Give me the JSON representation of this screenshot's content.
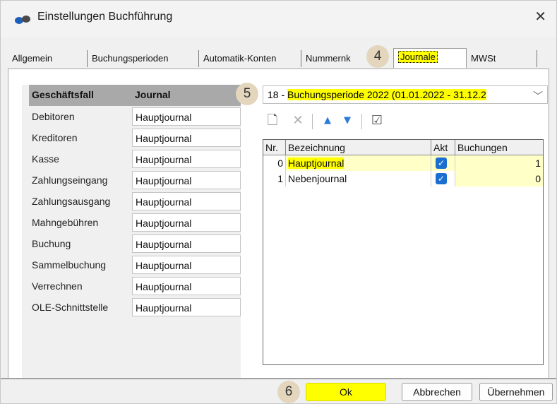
{
  "window": {
    "title": "Einstellungen Buchführung",
    "close_glyph": "✕",
    "icon": "app-icon"
  },
  "tabs": [
    {
      "label": "Allgemein"
    },
    {
      "label": "Buchungsperioden"
    },
    {
      "label": "Automatik-Konten"
    },
    {
      "label": "Nummernk"
    },
    {
      "label": "Journale",
      "selected": true
    },
    {
      "label": "MWSt"
    }
  ],
  "badges": {
    "b4": "4",
    "b5": "5",
    "b6": "6"
  },
  "left_table": {
    "headers": {
      "col1": "Geschäftsfall",
      "col2": "Journal"
    },
    "rows": [
      {
        "fall": "Debitoren",
        "journal": "Hauptjournal"
      },
      {
        "fall": "Kreditoren",
        "journal": "Hauptjournal"
      },
      {
        "fall": "Kasse",
        "journal": "Hauptjournal"
      },
      {
        "fall": "Zahlungseingang",
        "journal": "Hauptjournal"
      },
      {
        "fall": "Zahlungsausgang",
        "journal": "Hauptjournal"
      },
      {
        "fall": "Mahngebühren",
        "journal": "Hauptjournal"
      },
      {
        "fall": "Buchung",
        "journal": "Hauptjournal"
      },
      {
        "fall": "Sammelbuchung",
        "journal": "Hauptjournal"
      },
      {
        "fall": "Verrechnen",
        "journal": "Hauptjournal"
      },
      {
        "fall": "OLE-Schnittstelle",
        "journal": "Hauptjournal"
      }
    ]
  },
  "period_combo": {
    "prefix": "18 - ",
    "value": "Buchungsperiode 2022 (01.01.2022 - 31.12.2",
    "chevron": "﹀"
  },
  "toolbar": {
    "new": "🗋",
    "delete": "✕",
    "up": "▲",
    "down": "▼",
    "check": "☑"
  },
  "grid": {
    "headers": {
      "nr": "Nr.",
      "bez": "Bezeichnung",
      "akt": "Akt",
      "buch": "Buchungen"
    },
    "rows": [
      {
        "nr": "0",
        "bez": "Hauptjournal",
        "akt": true,
        "buch": "1"
      },
      {
        "nr": "1",
        "bez": "Nebenjournal",
        "akt": true,
        "buch": "0"
      }
    ]
  },
  "buttons": {
    "ok": "Ok",
    "cancel": "Abbrechen",
    "apply": "Übernehmen"
  },
  "colors": {
    "highlight": "#ffff00",
    "check": "#1a6fd1",
    "badge": "#e3d6bd"
  }
}
